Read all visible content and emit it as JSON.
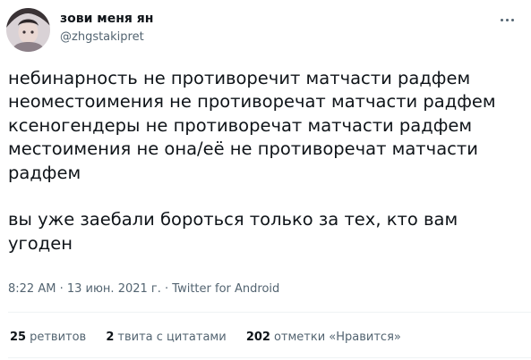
{
  "author": {
    "name": "зови меня ян",
    "handle": "@zhgstakipret"
  },
  "tweet": {
    "lines": [
      "небинарность не противоречит матчасти радфем",
      "неоместоимения не противоречат матчасти радфем",
      "ксеногендеры не противоречат матчасти радфем",
      "местоимения не она/её не противоречат матчасти",
      "радфем",
      "",
      "вы уже заебали бороться только за тех, кто вам",
      "угоден"
    ]
  },
  "meta": {
    "time": "8:22 AM",
    "separator": "·",
    "date": "13 июн. 2021 г.",
    "source": "Twitter for Android"
  },
  "stats": {
    "retweets": {
      "count": "25",
      "label": "ретвитов"
    },
    "quotes": {
      "count": "2",
      "label": "твита с цитатами"
    },
    "likes": {
      "count": "202",
      "label": "отметки «Нравится»"
    }
  },
  "icons": {
    "more": "more-horizontal-icon"
  }
}
